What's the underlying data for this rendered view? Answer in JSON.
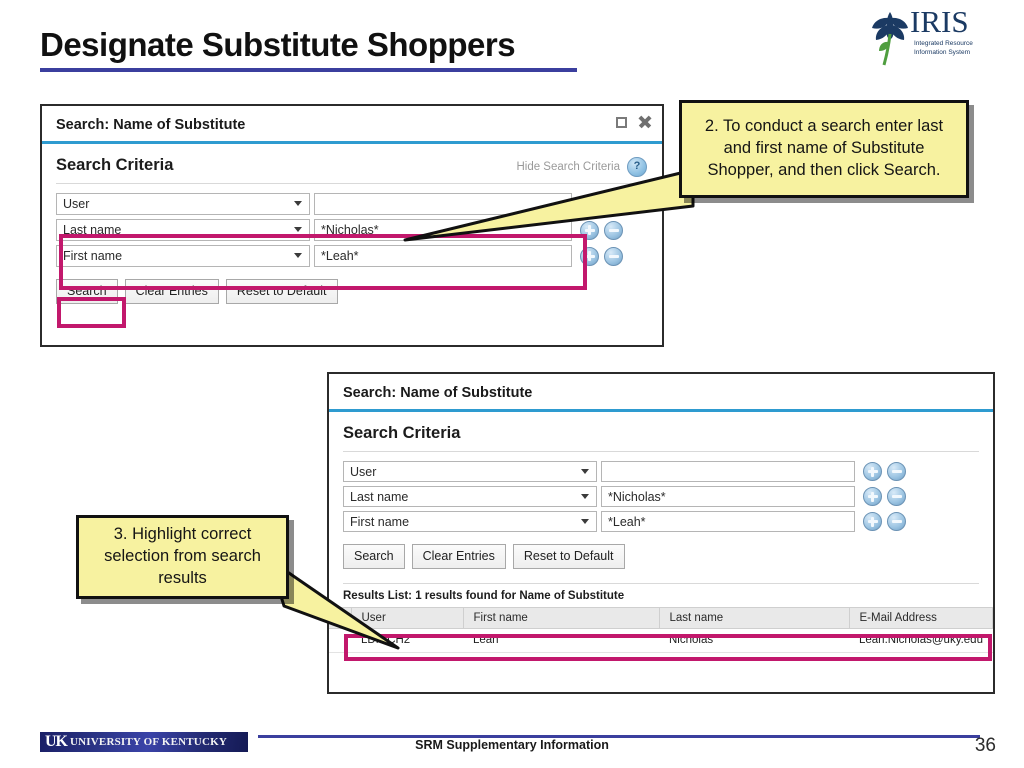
{
  "slide": {
    "title": "Designate Substitute Shoppers",
    "page_number": "36",
    "accent_color": "#3b3f9e",
    "highlight_color": "#c2186c",
    "callout_fill": "#f7f2a0"
  },
  "logo": {
    "iris_word": "IRIS",
    "iris_subtitle_line1": "Integrated Resource",
    "iris_subtitle_line2": "Information System",
    "uk_mark": "UK",
    "uk_name": "UNIVERSITY OF KENTUCKY"
  },
  "dialog1": {
    "window_title": "Search: Name of Substitute",
    "section_title": "Search Criteria",
    "hide_criteria_label": "Hide Search Criteria",
    "help_glyph": "?",
    "rows": [
      {
        "field": "User",
        "value": ""
      },
      {
        "field": "Last name",
        "value": "*Nicholas*"
      },
      {
        "field": "First name",
        "value": "*Leah*"
      }
    ],
    "buttons": {
      "search": "Search",
      "clear": "Clear Entries",
      "reset": "Reset to Default"
    }
  },
  "dialog2": {
    "window_title": "Search: Name of Substitute",
    "section_title": "Search Criteria",
    "rows": [
      {
        "field": "User",
        "value": ""
      },
      {
        "field": "Last name",
        "value": "*Nicholas*"
      },
      {
        "field": "First name",
        "value": "*Leah*"
      }
    ],
    "buttons": {
      "search": "Search",
      "clear": "Clear Entries",
      "reset": "Reset to Default"
    },
    "results": {
      "label": "Results List: 1 results found for Name of Substitute",
      "columns": [
        "User",
        "First name",
        "Last name",
        "E-Mail Address"
      ],
      "rows": [
        {
          "user": "LDNICH2",
          "first_name": "Leah",
          "last_name": "Nicholas",
          "email": "Leah.Nicholas@uky.edu"
        }
      ]
    }
  },
  "callouts": {
    "step2": "2. To conduct a search enter last and first name of Substitute Shopper, and then click Search.",
    "step3": "3. Highlight correct selection from search results"
  },
  "footer": {
    "text": "SRM Supplementary Information"
  }
}
